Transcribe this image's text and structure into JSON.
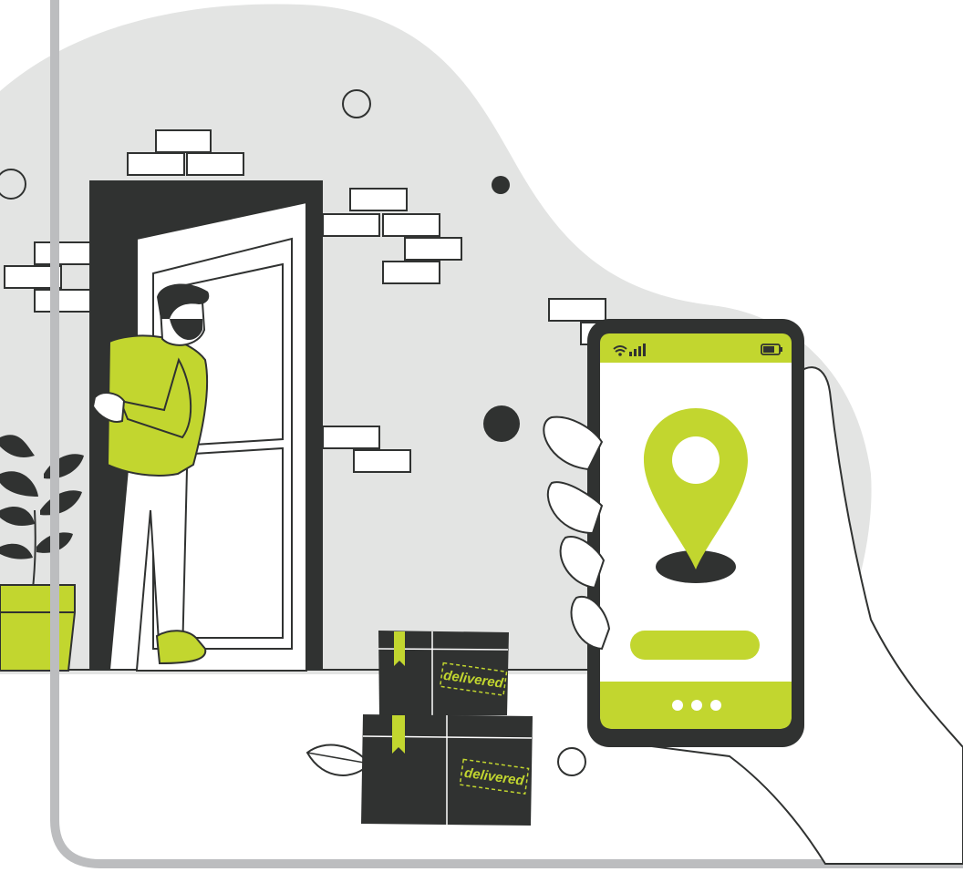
{
  "illustration": {
    "colors": {
      "accent": "#c2d62f",
      "dark": "#303231",
      "backdrop": "#e3e4e3",
      "frame": "#bcbdbf",
      "white": "#ffffff"
    },
    "packages": [
      {
        "stamp": "delivered"
      },
      {
        "stamp": "delivered"
      }
    ],
    "phone": {
      "status_icons": [
        "wifi-icon",
        "signal-icon",
        "battery-icon"
      ],
      "screen_icon": "location-pin-icon",
      "dots": 3
    },
    "elements": [
      "person-in-doorway",
      "potted-plant",
      "delivery-packages",
      "hand-holding-phone"
    ]
  }
}
